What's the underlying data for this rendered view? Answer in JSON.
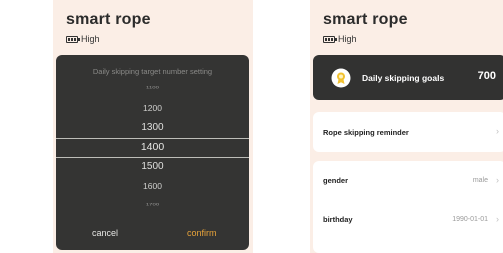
{
  "left_screen": {
    "app_title": "smart rope",
    "battery_level": "High",
    "picker": {
      "title": "Daily skipping target number setting",
      "options": [
        "1100",
        "1200",
        "1300",
        "1400",
        "1500",
        "1600",
        "1700"
      ],
      "selected": "1400",
      "cancel_label": "cancel",
      "confirm_label": "confirm",
      "confirm_color": "#e7a33a"
    }
  },
  "right_screen": {
    "app_title": "smart rope",
    "battery_level": "High",
    "goals": {
      "label": "Daily skipping goals",
      "value": "700",
      "icon": "medal-icon"
    },
    "reminder": {
      "label": "Rope skipping reminder",
      "icon": "chevron-right-icon"
    },
    "profile": [
      {
        "label": "gender",
        "value": "male"
      },
      {
        "label": "birthday",
        "value": "1990-01-01"
      }
    ]
  },
  "colors": {
    "background": "#fbeee6",
    "dark_card": "#343433",
    "accent": "#e7a33a"
  }
}
